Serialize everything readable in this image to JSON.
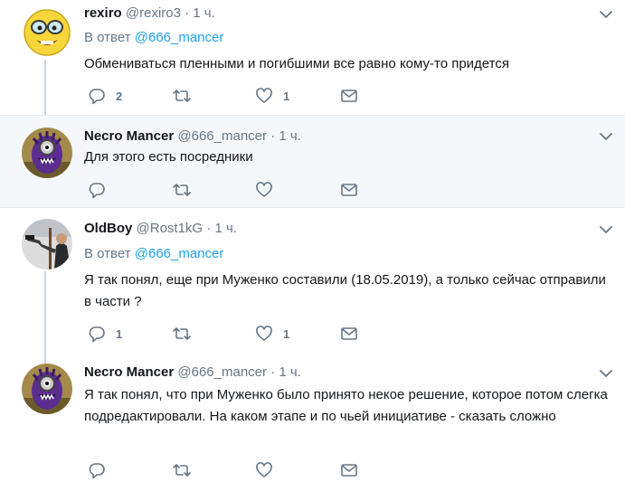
{
  "reply_prefix": "В ответ",
  "tweets": [
    {
      "name": "rexiro",
      "handle": "@rexiro3",
      "sep": "·",
      "time": "1 ч.",
      "reply_to": "@666_mancer",
      "text": "Обмениваться пленными и погибшими все равно кому-то придется",
      "replies": "2",
      "retweets": "",
      "likes": "1",
      "avatar": "emoji-glasses-avatar"
    },
    {
      "name": "Necro Mancer",
      "handle": "@666_mancer",
      "sep": "·",
      "time": "1 ч.",
      "reply_to": "",
      "text": "Для этого есть посредники",
      "replies": "",
      "retweets": "",
      "likes": "",
      "avatar": "purple-minion-avatar"
    },
    {
      "name": "OldBoy",
      "handle": "@Rost1kG",
      "sep": "·",
      "time": "1 ч.",
      "reply_to": "@666_mancer",
      "text": "Я так понял, еще при Муженко составили (18.05.2019), а только сейчас отправили в части ?",
      "replies": "1",
      "retweets": "",
      "likes": "1",
      "avatar": "man-with-gun-avatar"
    },
    {
      "name": "Necro Mancer",
      "handle": "@666_mancer",
      "sep": "·",
      "time": "1 ч.",
      "reply_to": "",
      "text": "Я так понял, что при Муженко было принято некое решение, которое потом слегка подредактировали. На каком этапе и по чьей инициативе - сказать сложно",
      "replies": "",
      "retweets": "",
      "likes": "",
      "avatar": "purple-minion-avatar"
    }
  ],
  "colors": {
    "link": "#1da1f2",
    "muted": "#657786",
    "highlight_bg": "#f5f8fa",
    "border": "#e6ecf0",
    "thread_line": "#ccd6dd"
  }
}
